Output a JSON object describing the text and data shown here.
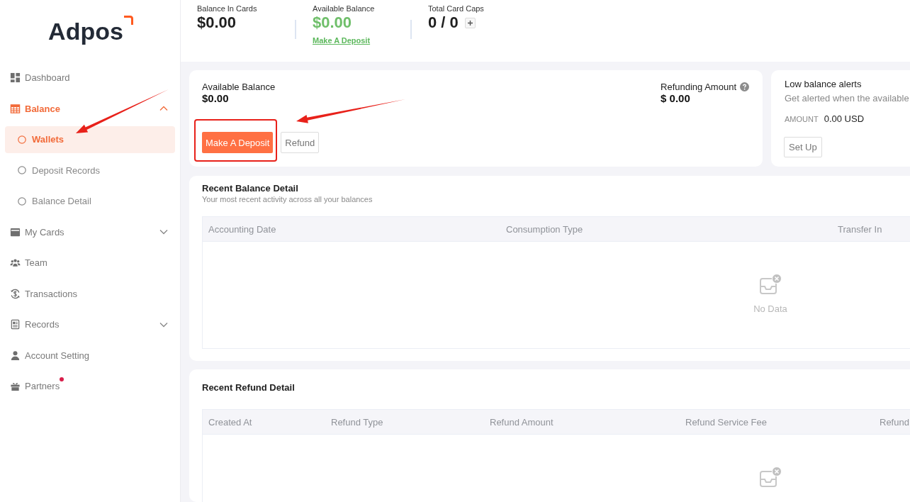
{
  "sidebar": {
    "logo": "Adpos",
    "items": [
      {
        "label": "Dashboard",
        "kind": "link",
        "selected": false,
        "badge_dot": false
      },
      {
        "label": "Balance",
        "kind": "group",
        "selected": true,
        "expanded": true,
        "badge_dot": false,
        "children": [
          {
            "label": "Wallets",
            "selected": true
          },
          {
            "label": "Deposit Records",
            "selected": false
          },
          {
            "label": "Balance Detail",
            "selected": false
          }
        ]
      },
      {
        "label": "My Cards",
        "kind": "group",
        "selected": false,
        "expanded": false,
        "badge_dot": false
      },
      {
        "label": "Team",
        "kind": "link",
        "selected": false,
        "badge_dot": false
      },
      {
        "label": "Transactions",
        "kind": "link",
        "selected": false,
        "badge_dot": false
      },
      {
        "label": "Records",
        "kind": "group",
        "selected": false,
        "expanded": false,
        "badge_dot": false
      },
      {
        "label": "Account Setting",
        "kind": "link",
        "selected": false,
        "badge_dot": false
      },
      {
        "label": "Partners",
        "kind": "link",
        "selected": false,
        "badge_dot": true
      }
    ]
  },
  "summary": [
    {
      "label": "Balance In Cards",
      "value": "$0.00",
      "kind": "plain"
    },
    {
      "label": "Available Balance",
      "value": "$0.00",
      "kind": "positive",
      "link": "Make A Deposit"
    },
    {
      "label": "Total Card Caps",
      "value": "0 / 0",
      "kind": "with_add"
    }
  ],
  "balance_card": {
    "label": "Available Balance",
    "value": "$0.00",
    "buttons": [
      {
        "label": "Make A Deposit",
        "kind": "primary"
      },
      {
        "label": "Refund",
        "kind": "default"
      }
    ],
    "refunding": {
      "label": "Refunding Amount",
      "value": "$ 0.00"
    }
  },
  "alerts_card": {
    "title": "Low balance alerts",
    "description": "Get alerted when the available",
    "amount_label": "AMOUNT",
    "amount": "0.00 USD",
    "button": "Set Up"
  },
  "tables": [
    {
      "title": "Recent Balance Detail",
      "subtitle": "Your most recent activity across all your balances",
      "columns": [
        "Accounting Date",
        "Consumption Type",
        "Transfer In"
      ],
      "empty_text": "No Data"
    },
    {
      "title": "Recent Refund Detail",
      "columns": [
        "Created At",
        "Refund Type",
        "Refund Amount",
        "Refund Service Fee",
        "Refund"
      ]
    }
  ]
}
